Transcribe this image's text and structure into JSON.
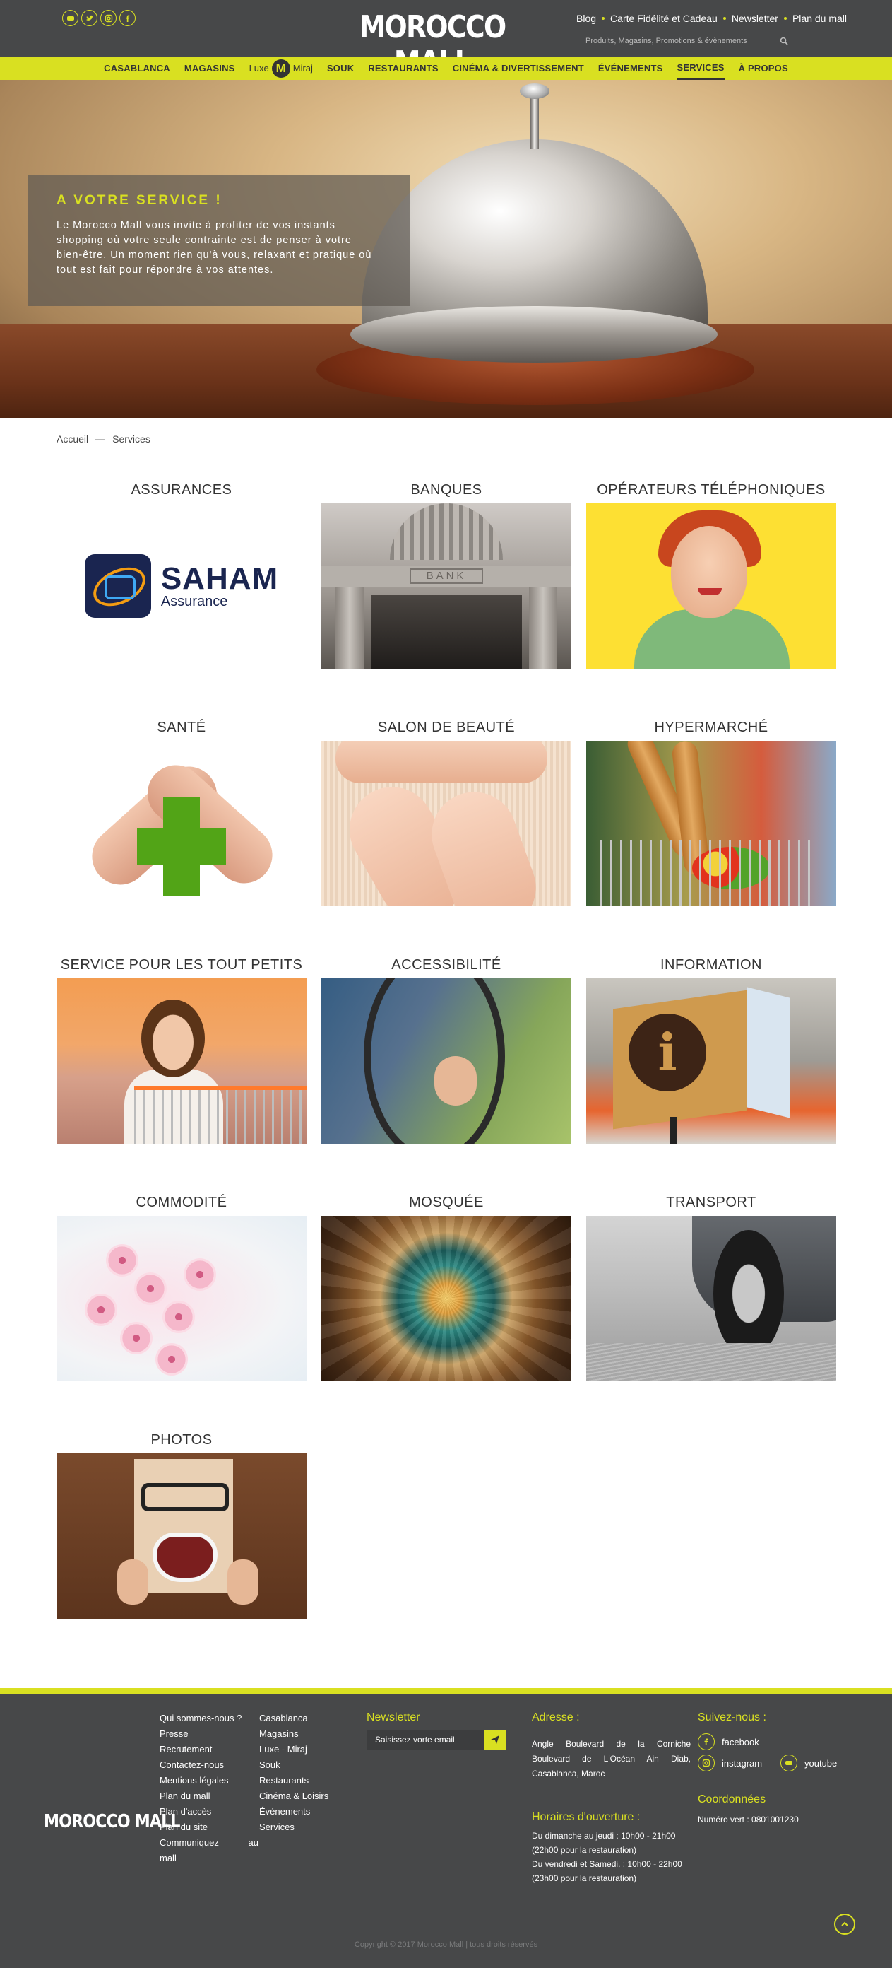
{
  "header": {
    "logo": "MOROCCO MALL",
    "top_links": [
      "Blog",
      "Carte Fidélité et Cadeau",
      "Newsletter",
      "Plan du mall"
    ],
    "search_placeholder": "Produits, Magasins, Promotions & évènements",
    "socials": [
      "youtube-icon",
      "twitter-icon",
      "instagram-icon",
      "facebook-icon"
    ]
  },
  "nav": {
    "items": [
      "CASABLANCA",
      "MAGASINS",
      "SOUK",
      "RESTAURANTS",
      "CINÉMA & DIVERTISSEMENT",
      "ÉVÉNEMENTS",
      "SERVICES",
      "À PROPOS"
    ],
    "luxe_left": "Luxe",
    "luxe_logo": "M",
    "luxe_right": "Miraj",
    "active": "SERVICES"
  },
  "hero": {
    "title": "A VOTRE SERVICE !",
    "text": "Le Morocco Mall vous invite à profiter de vos instants shopping où votre seule contrainte est de penser à votre bien-être. Un moment rien qu'à vous, relaxant et pratique où tout est fait pour répondre à vos attentes."
  },
  "breadcrumb": {
    "home": "Accueil",
    "current": "Services"
  },
  "services": [
    {
      "title": "ASSURANCES",
      "logo_big": "SAHAM",
      "logo_small": "Assurance"
    },
    {
      "title": "BANQUES",
      "sign": "BANK"
    },
    {
      "title": "OPÉRATEURS TÉLÉPHONIQUES"
    },
    {
      "title": "SANTÉ"
    },
    {
      "title": "SALON DE BEAUTÉ"
    },
    {
      "title": "HYPERMARCHÉ"
    },
    {
      "title": "SERVICE POUR LES TOUT PETITS"
    },
    {
      "title": "ACCESSIBILITÉ"
    },
    {
      "title": "INFORMATION",
      "sign": "i"
    },
    {
      "title": "COMMODITÉ"
    },
    {
      "title": "MOSQUÉE"
    },
    {
      "title": "TRANSPORT"
    },
    {
      "title": "PHOTOS"
    }
  ],
  "footer": {
    "logo": "MOROCCO MALL",
    "col1": [
      "Qui sommes-nous ?",
      "Presse",
      "Recrutement",
      "Contactez-nous",
      "Mentions légales",
      "Plan du mall",
      "Plan d'accès",
      "Plan du site",
      "Communiquez au mall"
    ],
    "col2": [
      "Casablanca",
      "Magasins",
      "Luxe - Miraj",
      "Souk",
      "Restaurants",
      "Cinéma & Loisirs",
      "Événements",
      "Services"
    ],
    "newsletter_title": "Newsletter",
    "newsletter_placeholder": "Saisissez vorte email",
    "address_title": "Adresse :",
    "address": "Angle Boulevard de la Corniche Boulevard de L'Océan Ain Diab, Casablanca, Maroc",
    "hours_title": "Horaires d'ouverture :",
    "hours_1": "Du dimanche au jeudi : 10h00 - 21h00",
    "hours_1b": "(22h00 pour la restauration)",
    "hours_2": "Du vendredi et Samedi. : 10h00 - 22h00",
    "hours_2b": "(23h00 pour la restauration)",
    "follow_title": "Suivez-nous :",
    "social_facebook": "facebook",
    "social_instagram": "instagram",
    "social_youtube": "youtube",
    "coords_title": "Coordonnées",
    "phone": "Numéro vert : 0801001230",
    "copyright": "Copyright © 2017 Morocco Mall | tous droits réservés"
  },
  "colors": {
    "accent": "#d9e021",
    "dark": "#474849"
  }
}
